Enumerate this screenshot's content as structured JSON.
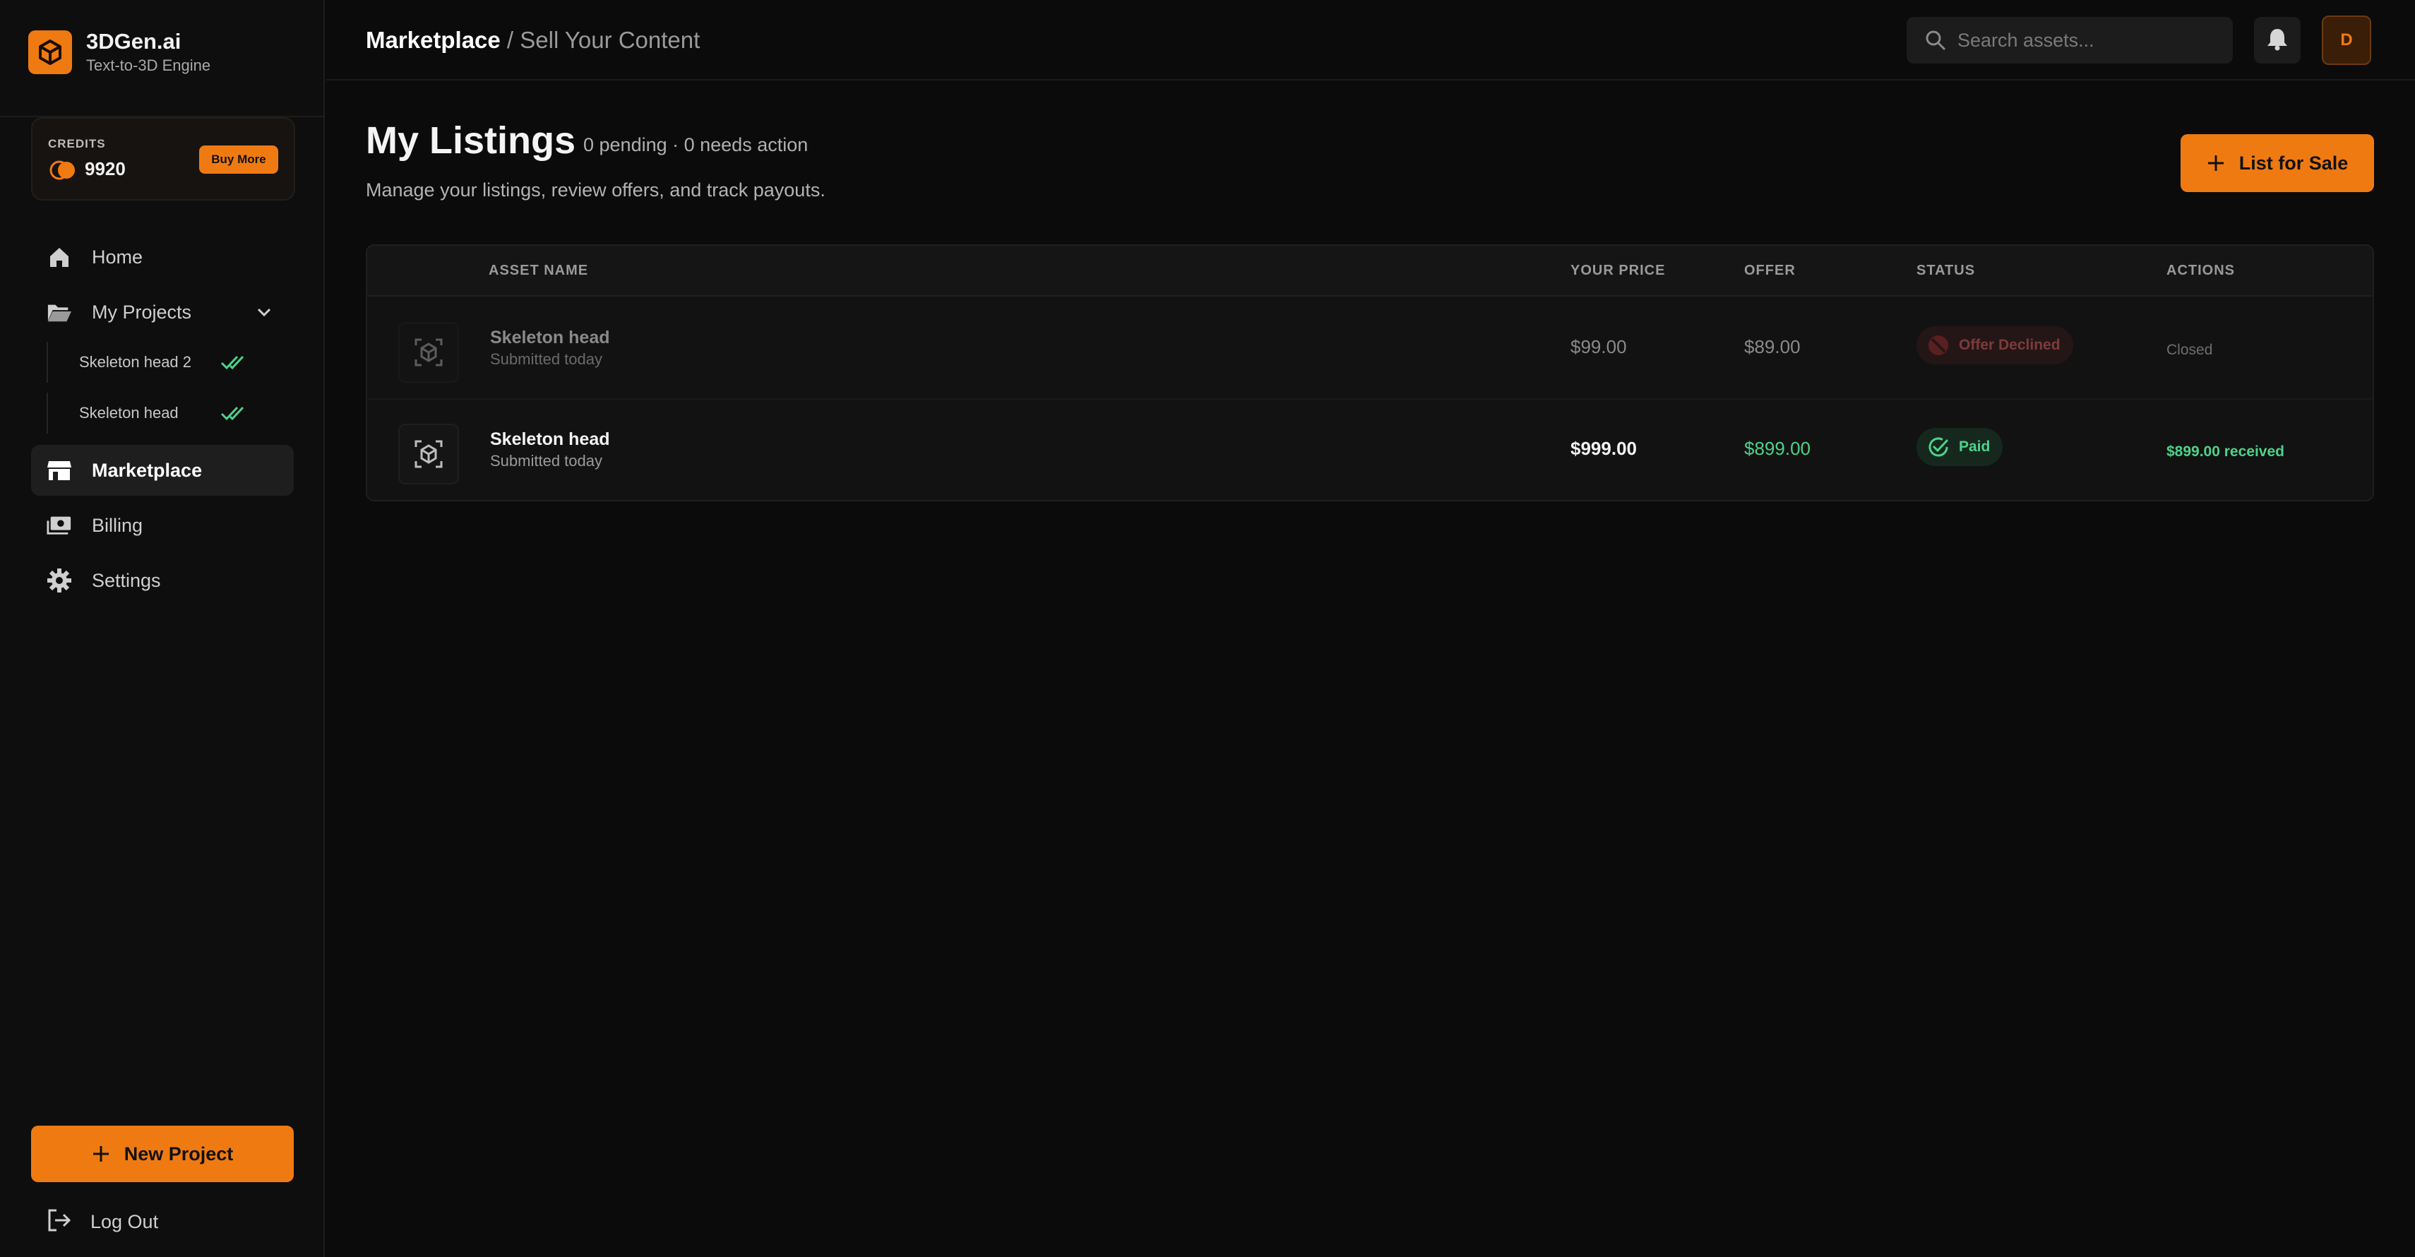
{
  "brand": {
    "name": "3DGen.ai",
    "tagline": "Text-to-3D Engine"
  },
  "credits": {
    "label": "CREDITS",
    "value": "9920",
    "buy_label": "Buy More"
  },
  "nav": {
    "home": "Home",
    "projects": "My Projects",
    "project_items": [
      "Skeleton head 2",
      "Skeleton head"
    ],
    "marketplace": "Marketplace",
    "billing": "Billing",
    "settings": "Settings"
  },
  "new_project_label": "New Project",
  "logout_label": "Log Out",
  "breadcrumb": {
    "section": "Marketplace",
    "separator": " / ",
    "page": "Sell Your Content"
  },
  "search": {
    "placeholder": "Search assets..."
  },
  "user": {
    "initial": "D"
  },
  "page": {
    "title": "My Listings",
    "meta": "0 pending · 0 needs action",
    "description": "Manage your listings, review offers, and track payouts.",
    "list_button": "List for Sale"
  },
  "table": {
    "columns": {
      "asset": "ASSET NAME",
      "price": "YOUR PRICE",
      "offer": "OFFER",
      "status": "STATUS",
      "actions": "ACTIONS"
    },
    "rows": [
      {
        "name": "Skeleton head",
        "submitted": "Submitted today",
        "price": "$99.00",
        "offer": "$89.00",
        "status": "Offer Declined",
        "action": "Closed"
      },
      {
        "name": "Skeleton head",
        "submitted": "Submitted today",
        "price": "$999.00",
        "offer": "$899.00",
        "status": "Paid",
        "action": "$899.00 received"
      }
    ]
  },
  "colors": {
    "accent": "#f07a12",
    "success": "#4ed28a",
    "declined": "#7e3a3a",
    "background": "#0b0b0b"
  }
}
